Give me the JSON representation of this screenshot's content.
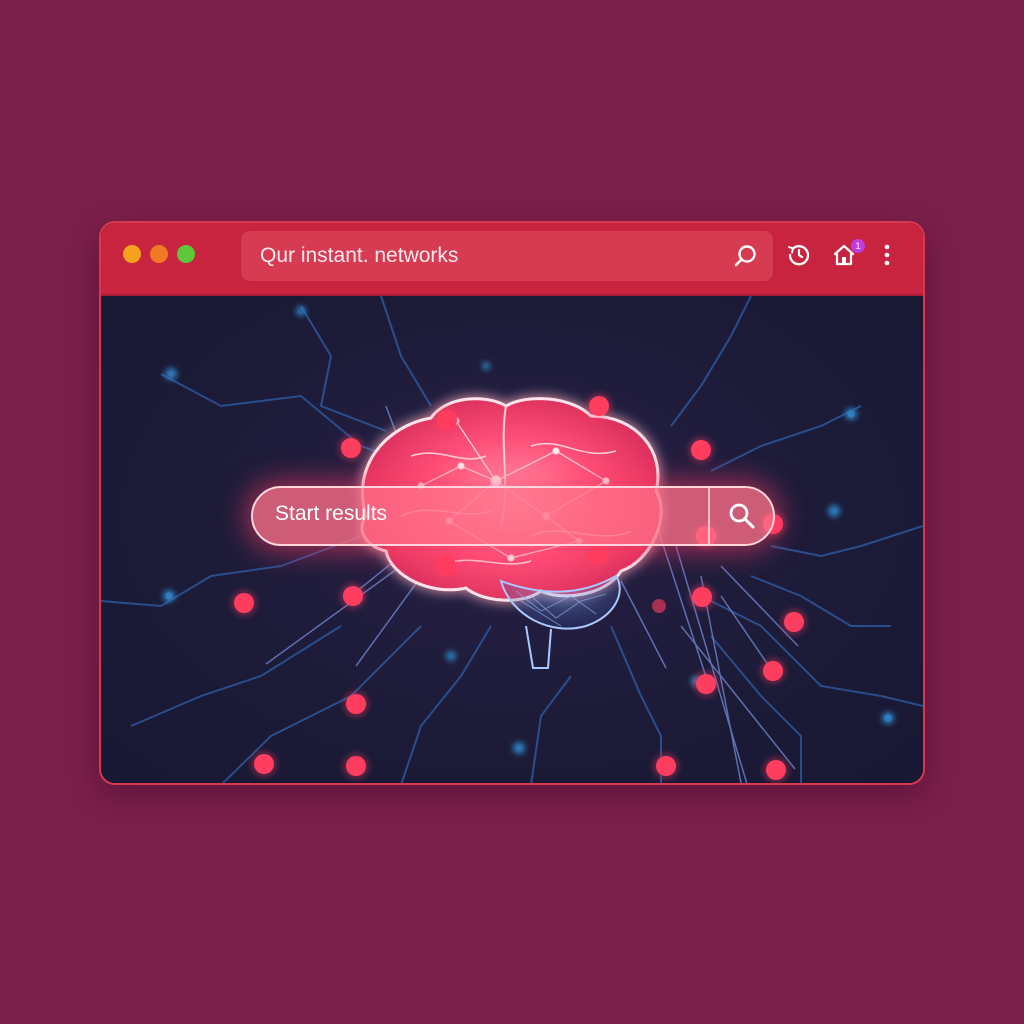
{
  "address_bar": {
    "text": "Qur instant. networks"
  },
  "toolbar": {
    "window_controls": [
      "close-dot",
      "minimize-dot",
      "maximize-dot"
    ],
    "icons": [
      "search-icon",
      "history-icon",
      "home-icon",
      "more-menu-icon"
    ],
    "notification_badge": "1"
  },
  "main": {
    "search_placeholder": "Start results",
    "search_button_icon": "search-icon",
    "illustration": "glowing-brain-network"
  },
  "colors": {
    "page_background": "#7b1f4b",
    "titlebar": "#c8233f",
    "address_bar": "#d73b52",
    "content_background": "#1c1b38",
    "node_red": "#ff3d5e",
    "node_blue": "#2f7fbf",
    "brain_glow": "#ff4f78",
    "badge": "#c33ce0"
  }
}
